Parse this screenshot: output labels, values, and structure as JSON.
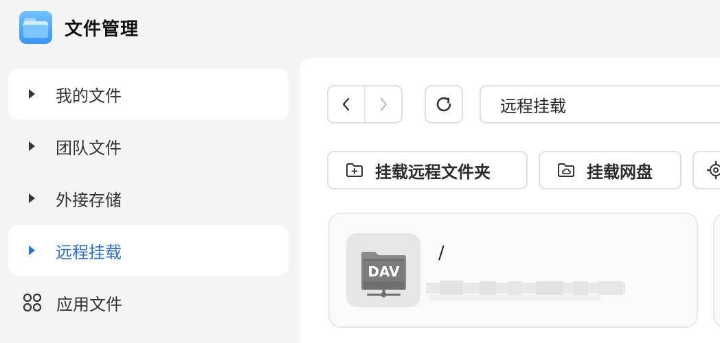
{
  "app": {
    "title": "文件管理",
    "logo_icon": "folder-icon",
    "accent": "#3a95f5"
  },
  "sidebar": {
    "items": [
      {
        "label": "我的文件",
        "icon": "caret-right-icon"
      },
      {
        "label": "团队文件",
        "icon": "caret-right-icon"
      },
      {
        "label": "外接存储",
        "icon": "caret-right-icon"
      },
      {
        "label": "远程挂载",
        "icon": "caret-right-icon",
        "selected": true
      },
      {
        "label": "应用文件",
        "icon": "app-grid-icon"
      }
    ],
    "selected_color": "#2a6fdc"
  },
  "toolbar": {
    "back_icon": "chevron-left-icon",
    "forward_icon": "chevron-right-icon",
    "refresh_icon": "refresh-icon",
    "path_value": "远程挂载"
  },
  "actions": {
    "mount_remote_folder": "挂载远程文件夹",
    "mount_netdisk": "挂载网盘"
  },
  "mounts": [
    {
      "name": "/",
      "type_badge": "DAV",
      "icon": "dav-folder-icon"
    }
  ]
}
